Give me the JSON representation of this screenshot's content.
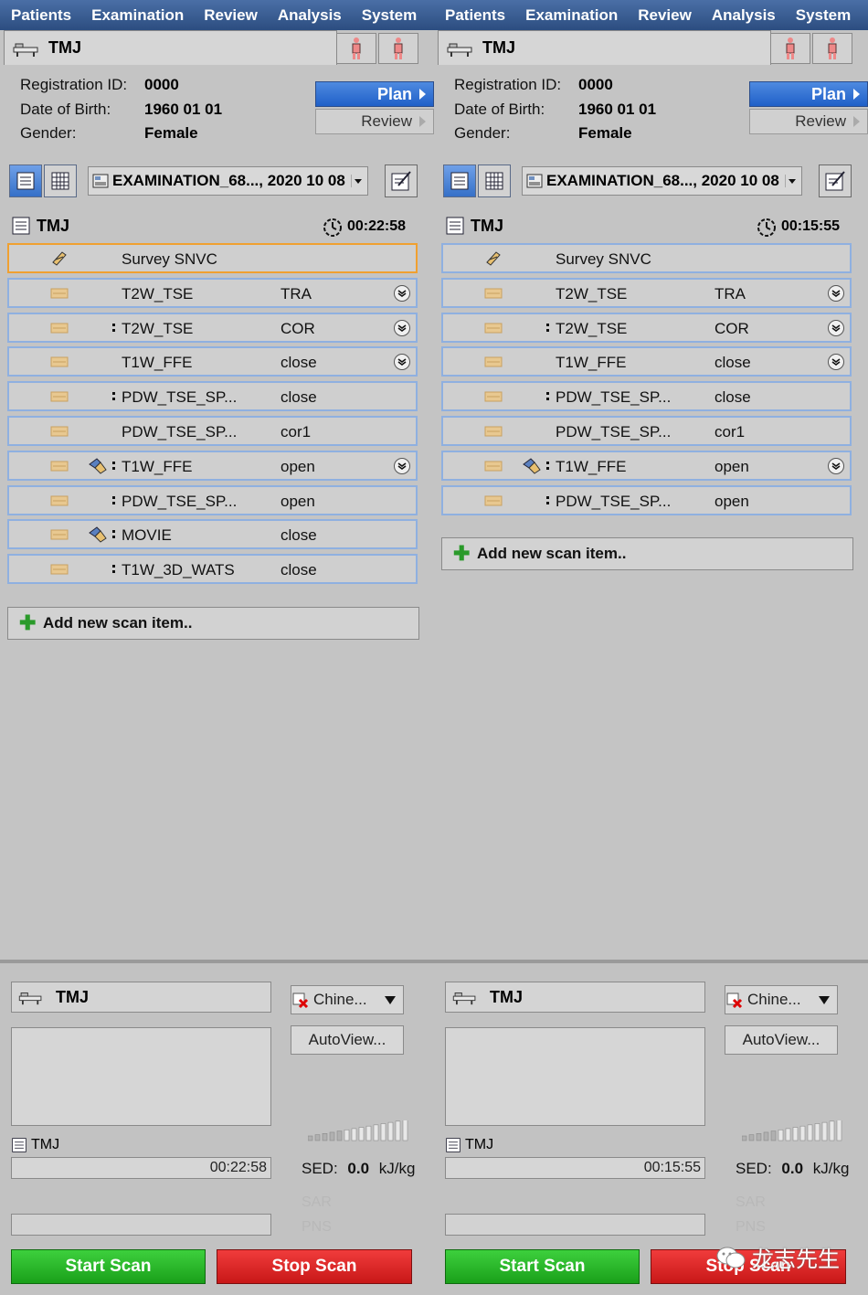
{
  "menu": [
    "Patients",
    "Examination",
    "Review",
    "Analysis",
    "System"
  ],
  "patient": {
    "name": "TMJ",
    "registration_label": "Registration ID:",
    "registration_id": "0000",
    "dob_label": "Date of Birth:",
    "dob": "1960 01 01",
    "gender_label": "Gender:",
    "gender": "Female"
  },
  "buttons": {
    "plan": "Plan",
    "review": "Review",
    "add_scan": "Add new scan item..",
    "autoview": "AutoView...",
    "start_scan": "Start Scan",
    "stop_scan": "Stop Scan"
  },
  "exam_select": "EXAMINATION_68..., 2020 10 08",
  "lang_select": "Chine...",
  "sed": {
    "label": "SED:",
    "value": "0.0",
    "unit": "kJ/kg"
  },
  "sar_label": "SAR",
  "pns_label": "PNS",
  "left": {
    "title": "TMJ",
    "timer": "00:22:58",
    "progress_time": "00:22:58",
    "bottom_name": "TMJ",
    "bottom_label": "TMJ",
    "scans": [
      {
        "name": "Survey SNVC",
        "orient": "",
        "icon": "survey",
        "dots": false,
        "tool": false,
        "expand": false,
        "selected": true
      },
      {
        "name": "T2W_TSE",
        "orient": "TRA",
        "icon": "scan",
        "dots": false,
        "tool": false,
        "expand": true
      },
      {
        "name": "T2W_TSE",
        "orient": "COR",
        "icon": "scan",
        "dots": true,
        "tool": false,
        "expand": true
      },
      {
        "name": "T1W_FFE",
        "orient": "close",
        "icon": "scan",
        "dots": false,
        "tool": false,
        "expand": true
      },
      {
        "name": "PDW_TSE_SP...",
        "orient": "close",
        "icon": "scan",
        "dots": true,
        "tool": false,
        "expand": false
      },
      {
        "name": "PDW_TSE_SP...",
        "orient": "cor1",
        "icon": "scan",
        "dots": false,
        "tool": false,
        "expand": false
      },
      {
        "name": "T1W_FFE",
        "orient": "open",
        "icon": "scan",
        "dots": true,
        "tool": true,
        "expand": true
      },
      {
        "name": "PDW_TSE_SP...",
        "orient": "open",
        "icon": "scan",
        "dots": true,
        "tool": false,
        "expand": false
      },
      {
        "name": "MOVIE",
        "orient": "close",
        "icon": "scan",
        "dots": true,
        "tool": true,
        "expand": false
      },
      {
        "name": "T1W_3D_WATS",
        "orient": "close",
        "icon": "scan",
        "dots": true,
        "tool": false,
        "expand": false
      }
    ]
  },
  "right": {
    "title": "TMJ",
    "timer": "00:15:55",
    "progress_time": "00:15:55",
    "bottom_name": "TMJ",
    "bottom_label": "TMJ",
    "scans": [
      {
        "name": "Survey SNVC",
        "orient": "",
        "icon": "survey",
        "dots": false,
        "tool": false,
        "expand": false,
        "selected": false
      },
      {
        "name": "T2W_TSE",
        "orient": "TRA",
        "icon": "scan",
        "dots": false,
        "tool": false,
        "expand": true
      },
      {
        "name": "T2W_TSE",
        "orient": "COR",
        "icon": "scan",
        "dots": true,
        "tool": false,
        "expand": true
      },
      {
        "name": "T1W_FFE",
        "orient": "close",
        "icon": "scan",
        "dots": false,
        "tool": false,
        "expand": true
      },
      {
        "name": "PDW_TSE_SP...",
        "orient": "close",
        "icon": "scan",
        "dots": true,
        "tool": false,
        "expand": false
      },
      {
        "name": "PDW_TSE_SP...",
        "orient": "cor1",
        "icon": "scan",
        "dots": false,
        "tool": false,
        "expand": false
      },
      {
        "name": "T1W_FFE",
        "orient": "open",
        "icon": "scan",
        "dots": true,
        "tool": true,
        "expand": true
      },
      {
        "name": "PDW_TSE_SP...",
        "orient": "open",
        "icon": "scan",
        "dots": true,
        "tool": false,
        "expand": false
      }
    ]
  },
  "watermark": "龙志先生",
  "colors": {
    "menubar": "#2c4d80",
    "plan": "#2060c8",
    "start": "#1aa01a",
    "stop": "#c81818",
    "selected_border": "#f0a030",
    "row_border": "#8fb0e0"
  }
}
